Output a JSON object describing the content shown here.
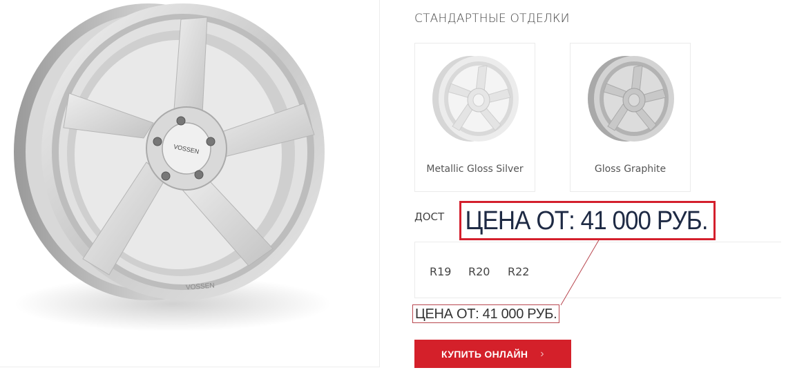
{
  "finishes": {
    "title": "СТАНДАРТНЫЕ ОТДЕЛКИ",
    "items": [
      {
        "name": "Metallic Gloss Silver",
        "color": "#dcdcdc"
      },
      {
        "name": "Gloss Graphite",
        "color": "#bdbdbd"
      }
    ]
  },
  "sizes": {
    "title": "ДОСТ",
    "items": [
      "R19",
      "R20",
      "R22"
    ]
  },
  "price": {
    "text": "ЦЕНА ОТ: 41 000 РУБ.",
    "zoom_text": "ЦЕНА ОТ: 41 000 РУБ."
  },
  "buy_button": {
    "label": "КУПИТЬ ОНЛАЙН",
    "icon": "chevron-right-icon",
    "color": "#d4202a"
  },
  "wheel": {
    "brand_label": "VOSSEN",
    "rim_label": "VOSSEN"
  }
}
